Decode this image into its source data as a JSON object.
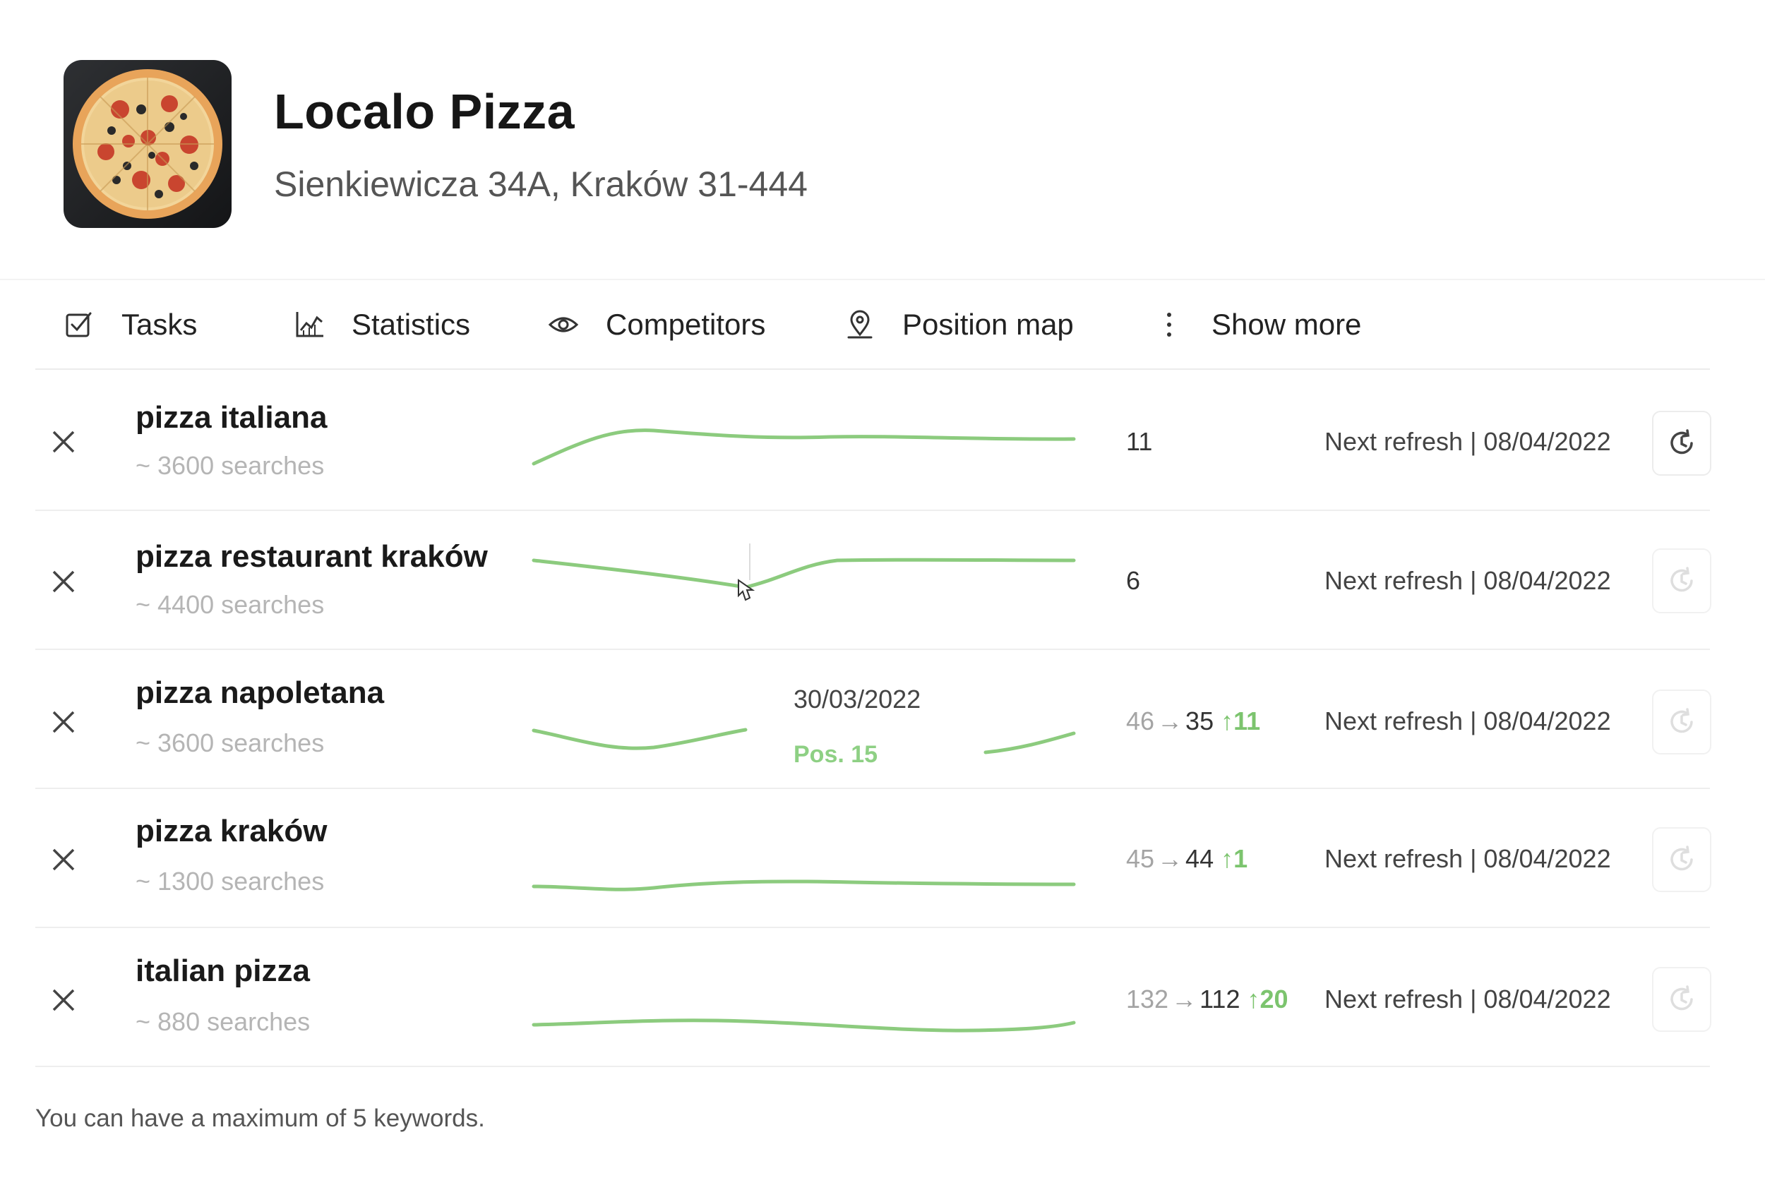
{
  "business": {
    "name": "Localo Pizza",
    "address": "Sienkiewicza 34A, Kraków 31-444"
  },
  "tabs": [
    {
      "label": "Tasks",
      "icon": "checkbox-icon"
    },
    {
      "label": "Statistics",
      "icon": "chart-icon"
    },
    {
      "label": "Competitors",
      "icon": "eye-icon"
    },
    {
      "label": "Position map",
      "icon": "map-pin-icon"
    },
    {
      "label": "Show more",
      "icon": "more-vertical-icon"
    }
  ],
  "keywords": [
    {
      "keyword": "pizza italiana",
      "searches": "~ 3600 searches",
      "position_old": "",
      "position": "11",
      "change": "",
      "refresh": "Next refresh | 08/04/2022"
    },
    {
      "keyword": "pizza restaurant kraków",
      "searches": "~ 4400 searches",
      "position_old": "",
      "position": "6",
      "change": "",
      "refresh": "Next refresh | 08/04/2022"
    },
    {
      "keyword": "pizza napoletana",
      "searches": "~ 3600 searches",
      "position_old": "46",
      "position": "35",
      "change": "11",
      "refresh": "Next refresh | 08/04/2022"
    },
    {
      "keyword": "pizza kraków",
      "searches": "~ 1300 searches",
      "position_old": "45",
      "position": "44",
      "change": "1",
      "refresh": "Next refresh | 08/04/2022"
    },
    {
      "keyword": "italian pizza",
      "searches": "~ 880 searches",
      "position_old": "132",
      "position": "112",
      "change": "20",
      "refresh": "Next refresh | 08/04/2022"
    }
  ],
  "tooltip": {
    "date": "30/03/2022",
    "position": "Pos. 15"
  },
  "footer": {
    "note": "You can have a maximum of 5 keywords."
  },
  "colors": {
    "sparkline": "#8ccb7e",
    "up": "#7cc46e"
  }
}
